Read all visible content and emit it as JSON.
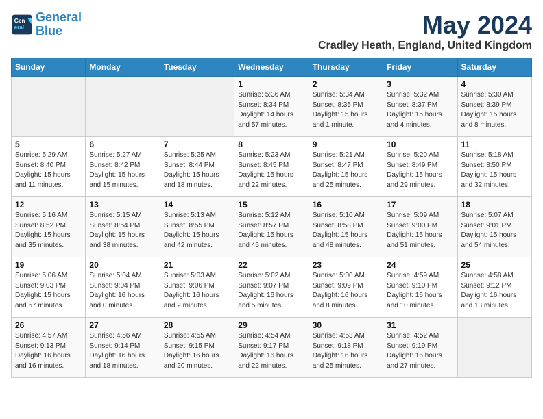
{
  "header": {
    "logo_line1": "General",
    "logo_line2": "Blue",
    "month_year": "May 2024",
    "location": "Cradley Heath, England, United Kingdom"
  },
  "weekdays": [
    "Sunday",
    "Monday",
    "Tuesday",
    "Wednesday",
    "Thursday",
    "Friday",
    "Saturday"
  ],
  "weeks": [
    [
      {
        "day": "",
        "info": ""
      },
      {
        "day": "",
        "info": ""
      },
      {
        "day": "",
        "info": ""
      },
      {
        "day": "1",
        "info": "Sunrise: 5:36 AM\nSunset: 8:34 PM\nDaylight: 14 hours\nand 57 minutes."
      },
      {
        "day": "2",
        "info": "Sunrise: 5:34 AM\nSunset: 8:35 PM\nDaylight: 15 hours\nand 1 minute."
      },
      {
        "day": "3",
        "info": "Sunrise: 5:32 AM\nSunset: 8:37 PM\nDaylight: 15 hours\nand 4 minutes."
      },
      {
        "day": "4",
        "info": "Sunrise: 5:30 AM\nSunset: 8:39 PM\nDaylight: 15 hours\nand 8 minutes."
      }
    ],
    [
      {
        "day": "5",
        "info": "Sunrise: 5:29 AM\nSunset: 8:40 PM\nDaylight: 15 hours\nand 11 minutes."
      },
      {
        "day": "6",
        "info": "Sunrise: 5:27 AM\nSunset: 8:42 PM\nDaylight: 15 hours\nand 15 minutes."
      },
      {
        "day": "7",
        "info": "Sunrise: 5:25 AM\nSunset: 8:44 PM\nDaylight: 15 hours\nand 18 minutes."
      },
      {
        "day": "8",
        "info": "Sunrise: 5:23 AM\nSunset: 8:45 PM\nDaylight: 15 hours\nand 22 minutes."
      },
      {
        "day": "9",
        "info": "Sunrise: 5:21 AM\nSunset: 8:47 PM\nDaylight: 15 hours\nand 25 minutes."
      },
      {
        "day": "10",
        "info": "Sunrise: 5:20 AM\nSunset: 8:49 PM\nDaylight: 15 hours\nand 29 minutes."
      },
      {
        "day": "11",
        "info": "Sunrise: 5:18 AM\nSunset: 8:50 PM\nDaylight: 15 hours\nand 32 minutes."
      }
    ],
    [
      {
        "day": "12",
        "info": "Sunrise: 5:16 AM\nSunset: 8:52 PM\nDaylight: 15 hours\nand 35 minutes."
      },
      {
        "day": "13",
        "info": "Sunrise: 5:15 AM\nSunset: 8:54 PM\nDaylight: 15 hours\nand 38 minutes."
      },
      {
        "day": "14",
        "info": "Sunrise: 5:13 AM\nSunset: 8:55 PM\nDaylight: 15 hours\nand 42 minutes."
      },
      {
        "day": "15",
        "info": "Sunrise: 5:12 AM\nSunset: 8:57 PM\nDaylight: 15 hours\nand 45 minutes."
      },
      {
        "day": "16",
        "info": "Sunrise: 5:10 AM\nSunset: 8:58 PM\nDaylight: 15 hours\nand 48 minutes."
      },
      {
        "day": "17",
        "info": "Sunrise: 5:09 AM\nSunset: 9:00 PM\nDaylight: 15 hours\nand 51 minutes."
      },
      {
        "day": "18",
        "info": "Sunrise: 5:07 AM\nSunset: 9:01 PM\nDaylight: 15 hours\nand 54 minutes."
      }
    ],
    [
      {
        "day": "19",
        "info": "Sunrise: 5:06 AM\nSunset: 9:03 PM\nDaylight: 15 hours\nand 57 minutes."
      },
      {
        "day": "20",
        "info": "Sunrise: 5:04 AM\nSunset: 9:04 PM\nDaylight: 16 hours\nand 0 minutes."
      },
      {
        "day": "21",
        "info": "Sunrise: 5:03 AM\nSunset: 9:06 PM\nDaylight: 16 hours\nand 2 minutes."
      },
      {
        "day": "22",
        "info": "Sunrise: 5:02 AM\nSunset: 9:07 PM\nDaylight: 16 hours\nand 5 minutes."
      },
      {
        "day": "23",
        "info": "Sunrise: 5:00 AM\nSunset: 9:09 PM\nDaylight: 16 hours\nand 8 minutes."
      },
      {
        "day": "24",
        "info": "Sunrise: 4:59 AM\nSunset: 9:10 PM\nDaylight: 16 hours\nand 10 minutes."
      },
      {
        "day": "25",
        "info": "Sunrise: 4:58 AM\nSunset: 9:12 PM\nDaylight: 16 hours\nand 13 minutes."
      }
    ],
    [
      {
        "day": "26",
        "info": "Sunrise: 4:57 AM\nSunset: 9:13 PM\nDaylight: 16 hours\nand 16 minutes."
      },
      {
        "day": "27",
        "info": "Sunrise: 4:56 AM\nSunset: 9:14 PM\nDaylight: 16 hours\nand 18 minutes."
      },
      {
        "day": "28",
        "info": "Sunrise: 4:55 AM\nSunset: 9:15 PM\nDaylight: 16 hours\nand 20 minutes."
      },
      {
        "day": "29",
        "info": "Sunrise: 4:54 AM\nSunset: 9:17 PM\nDaylight: 16 hours\nand 22 minutes."
      },
      {
        "day": "30",
        "info": "Sunrise: 4:53 AM\nSunset: 9:18 PM\nDaylight: 16 hours\nand 25 minutes."
      },
      {
        "day": "31",
        "info": "Sunrise: 4:52 AM\nSunset: 9:19 PM\nDaylight: 16 hours\nand 27 minutes."
      },
      {
        "day": "",
        "info": ""
      }
    ]
  ]
}
